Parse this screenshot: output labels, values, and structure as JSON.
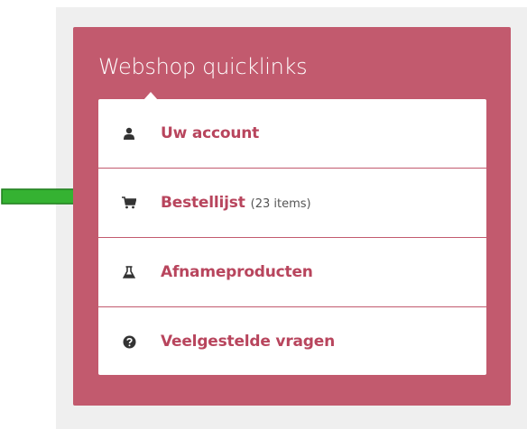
{
  "panel": {
    "title": "Webshop quicklinks"
  },
  "items": [
    {
      "label": "Uw account",
      "icon": "user-icon"
    },
    {
      "label": "Bestellijst",
      "count": "(23 items)",
      "icon": "cart-icon"
    },
    {
      "label": "Afnameproducten",
      "icon": "flask-icon"
    },
    {
      "label": "Veelgestelde vragen",
      "icon": "question-circle-icon"
    }
  ],
  "colors": {
    "panel": "#c25a6e",
    "link": "#b8455d",
    "arrow": "#35b232",
    "icon": "#333333"
  }
}
